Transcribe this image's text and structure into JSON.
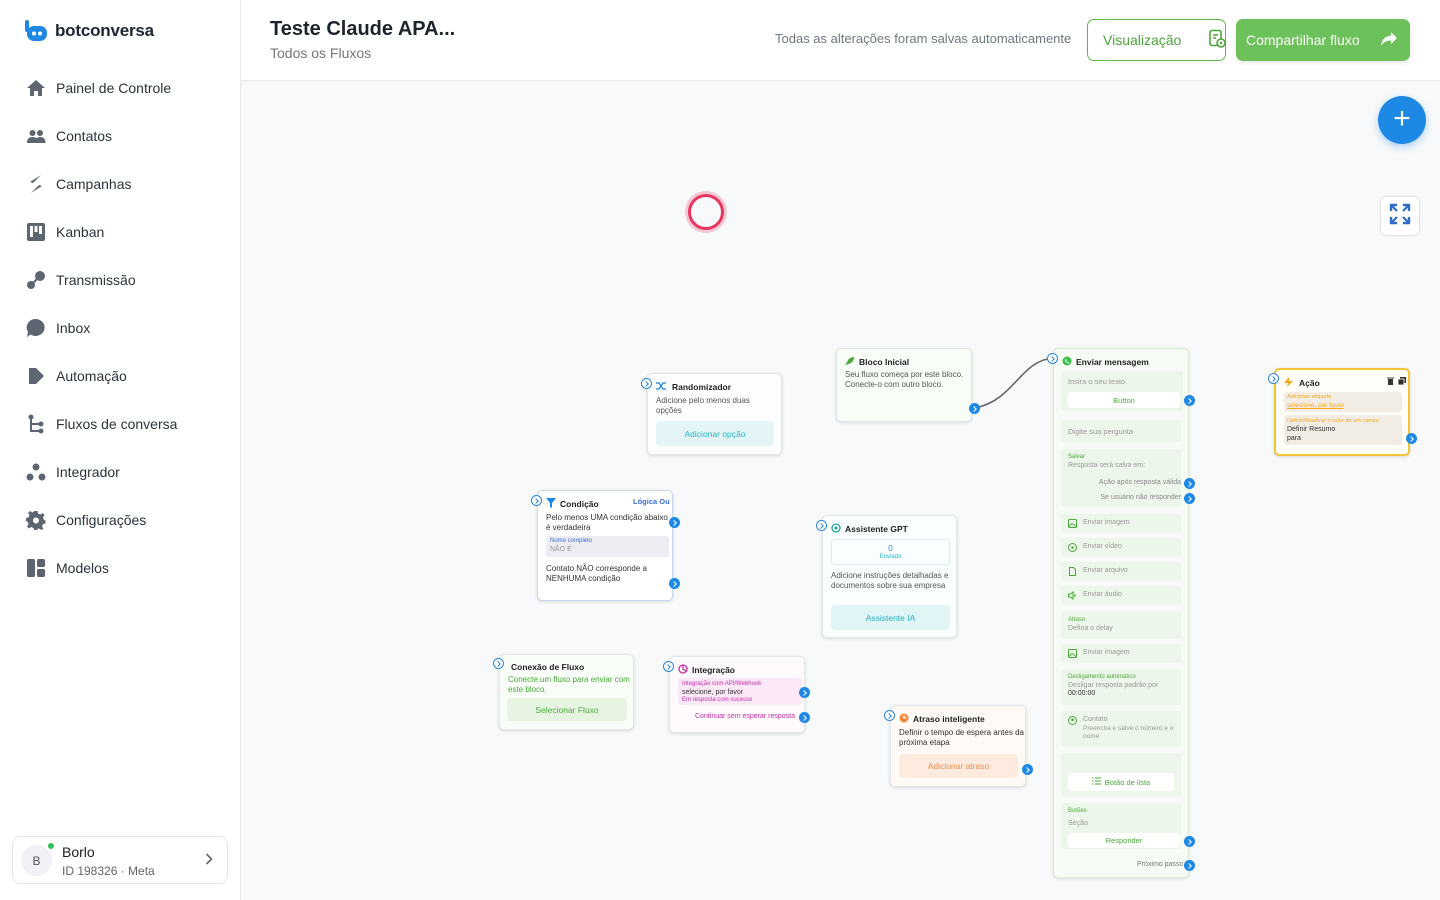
{
  "app": {
    "name": "botconversa"
  },
  "sidebar": {
    "items": [
      {
        "label": "Painel de Controle",
        "icon": "home-icon"
      },
      {
        "label": "Contatos",
        "icon": "users-icon"
      },
      {
        "label": "Campanhas",
        "icon": "campaign-icon"
      },
      {
        "label": "Kanban",
        "icon": "kanban-icon"
      },
      {
        "label": "Transmissão",
        "icon": "broadcast-icon"
      },
      {
        "label": "Inbox",
        "icon": "chat-icon"
      },
      {
        "label": "Automação",
        "icon": "automation-icon"
      },
      {
        "label": "Fluxos de conversa",
        "icon": "flow-icon"
      },
      {
        "label": "Integrador",
        "icon": "integrator-icon"
      },
      {
        "label": "Configurações",
        "icon": "gear-icon"
      },
      {
        "label": "Modelos",
        "icon": "templates-icon"
      }
    ],
    "user": {
      "initial": "B",
      "name": "Borlo",
      "sub": "ID 198326 · Meta",
      "status": "online"
    }
  },
  "header": {
    "title": "Teste Claude APA...",
    "subtitle": "Todos os Fluxos",
    "saved": "Todas as alterações foram salvas automaticamente",
    "view_label": "Visualização",
    "share_label": "Compartilhar fluxo"
  },
  "colors": {
    "brand_green": "#6cc15a",
    "accent_blue": "#1e88e5"
  },
  "nodes": {
    "randomizador": {
      "title": "Randomizador",
      "desc": "Adicione pelo menos duas opções",
      "button": "Adicionar opção"
    },
    "bloco_inicial": {
      "title": "Bloco Inicial",
      "desc": "Seu fluxo começa por este bloco. Conecte-o com outro bloco."
    },
    "condicao": {
      "title": "Condição",
      "logic": "Lógica Ou",
      "desc": "Pelo menos UMA condição abaixo é verdadeira",
      "field_label": "Nome completo",
      "field_value": "NÃO É",
      "else": "Contato NÃO corresponde a NENHUMA condição"
    },
    "gpt": {
      "title": "Assistente GPT",
      "count": "0",
      "count_label": "Enviado",
      "desc": "Adicione instruções detalhadas e documentos sobre sua empresa",
      "button": "Assistente IA"
    },
    "conexao": {
      "title": "Conexão de Fluxo",
      "desc": "Conecte um fluxo para enviar com este bloco.",
      "button": "Selecionar Fluxo"
    },
    "integracao": {
      "title": "Integração",
      "tag": "Integração com API/Webhook",
      "value": "selecione, por favor",
      "success": "Em resposta com sucesso",
      "continue": "Continuar sem esperar resposta"
    },
    "atraso": {
      "title": "Atraso inteligente",
      "desc": "Definir o tempo de espera antes da próxima etapa",
      "button": "Adicionar atraso"
    },
    "enviar": {
      "title": "Enviar mensagem",
      "text_placeholder": "Insira o seu texto",
      "button": "Button",
      "question": "Digite sua pergunta",
      "save_title": "Salvar",
      "save_desc": "Resposta será salva em:",
      "after_valid": "Ação após resposta válida",
      "if_no_reply": "Se usuário não responder",
      "send_image": "Enviar imagem",
      "send_video": "Enviar vídeo",
      "send_file": "Enviar arquivo",
      "send_audio": "Enviar áudio",
      "delay_title": "Atraso",
      "delay_desc": "Defina o delay",
      "send_image2": "Enviar imagem",
      "auto_off_title": "Desligamento automático",
      "auto_off_desc": "Desligar resposta padrão por",
      "auto_off_time": "00:00:00",
      "contact_title": "Contato",
      "contact_desc": "Preencha e salve o número e o nome",
      "list_button": "Botão de lista",
      "buttons_title": "Botões",
      "section": "Seção",
      "reply": "Responder",
      "next": "Próximo passo"
    },
    "acao": {
      "title": "Ação",
      "tag_label": "Adicionar etiqueta",
      "tag_value": "selecione, por favor",
      "field_label": "Definir/Atualizar o valor de um campo",
      "field_value": "Definir Resumo",
      "field_value2": "para"
    }
  }
}
